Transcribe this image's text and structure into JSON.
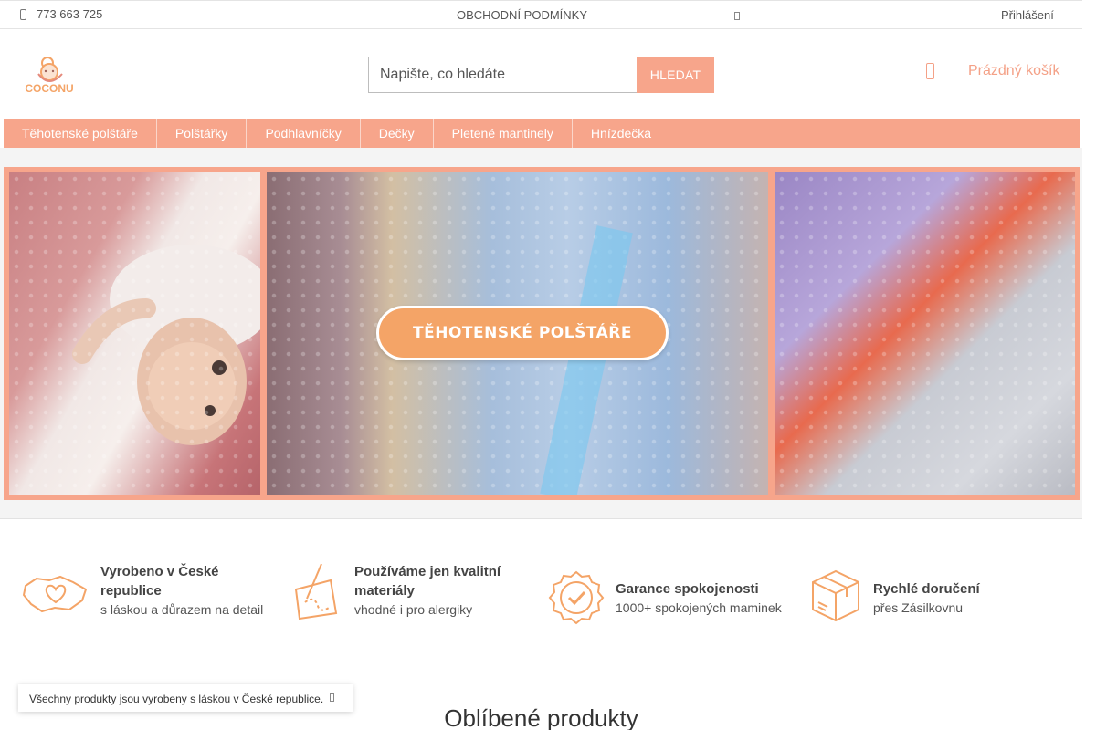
{
  "topbar": {
    "phone": "773 663 725",
    "terms": "OBCHODNÍ PODMÍNKY",
    "login": "Přihlášení"
  },
  "header": {
    "logo_text": "COCONU",
    "search_placeholder": "Napište, co hledáte",
    "search_button": "HLEDAT",
    "cart_label": "Prázdný košík"
  },
  "nav": {
    "items": [
      {
        "label": "Těhotenské polštáře"
      },
      {
        "label": "Polštářky"
      },
      {
        "label": "Podhlavníčky"
      },
      {
        "label": "Dečky"
      },
      {
        "label": "Pletené mantinely"
      },
      {
        "label": "Hnízdečka"
      }
    ]
  },
  "banner": {
    "cta": "TĚHOTENSKÉ POLŠTÁŘE"
  },
  "features": [
    {
      "title": "Vyrobeno v České republice",
      "sub": "s láskou a důrazem na detail",
      "icon": "czech-map-heart-icon"
    },
    {
      "title": "Používáme jen kvalitní materiály",
      "sub": "vhodné i pro alergiky",
      "icon": "fabric-needle-icon"
    },
    {
      "title": "Garance spokojenosti",
      "sub": "1000+ spokojených maminek",
      "icon": "check-badge-icon"
    },
    {
      "title": "Rychlé doručení",
      "sub": "přes Zásilkovnu",
      "icon": "package-box-icon"
    }
  ],
  "notice": {
    "text": "Všechny produkty jsou vyrobeny s láskou v České republice."
  },
  "sections": {
    "popular_title": "Oblíbené produkty"
  },
  "colors": {
    "accent": "#f7a58b",
    "icon": "#f4a467"
  }
}
